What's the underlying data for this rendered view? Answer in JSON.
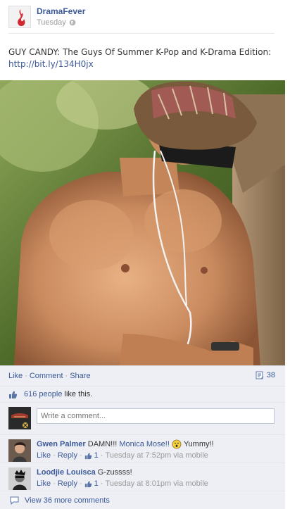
{
  "post": {
    "page_name": "DramaFever",
    "timestamp": "Tuesday",
    "message_text": "GUY CANDY: The Guys Of Summer K-Pop and K-Drama Edition:",
    "message_link": "http://bit.ly/134H0jx",
    "colors": {
      "link": "#3b5998",
      "ufi_background": "#edeff4",
      "brand_red": "#d22630"
    }
  },
  "actions": {
    "like": "Like",
    "comment": "Comment",
    "share": "Share",
    "separator": "·",
    "share_count": "38"
  },
  "likes": {
    "count_text": "616 people",
    "suffix": " like this."
  },
  "compose": {
    "placeholder": "Write a comment..."
  },
  "comments": [
    {
      "author": "Gwen Palmer",
      "text_before": " DAMN!!! ",
      "mention": "Monica Mose!!",
      "text_after": " Yummy!!",
      "like": "Like",
      "reply": "Reply",
      "likes": "1",
      "time": "Tuesday at 7:52pm via mobile"
    },
    {
      "author": "Loodjie Louisca",
      "text_before": " G-zussss!",
      "like": "Like",
      "reply": "Reply",
      "likes": "1",
      "time": "Tuesday at 8:01pm via mobile"
    }
  ],
  "more_comments": "View 36 more comments",
  "icons": {
    "avatar": "dramafever-flame-logo",
    "timestamp": "globe-icon",
    "share_count": "share-count-icon",
    "likes": "thumbs-up-icon",
    "comment_like": "thumbs-up-icon",
    "emoticon": "surprised-emoticon-icon",
    "more_comments": "speech-bubble-icon"
  }
}
